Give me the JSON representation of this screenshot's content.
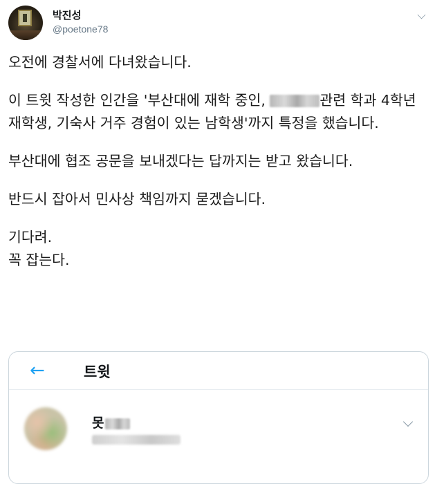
{
  "author": {
    "name": "박진성",
    "handle": "@poetone78"
  },
  "tweet": {
    "para1": "오전에 경찰서에 다녀왔습니다.",
    "para2_a": "이 트윗 작성한 인간을 '부산대에 재학 중인, ",
    "para2_b": "관련 학과 4학년 재학생, 기숙사 거주 경험이 있는 남학생'까지 특정을 했습니다.",
    "para3": "부산대에 협조 공문을 보내겠다는 답까지는 받고 왔습니다.",
    "para4": "반드시 잡아서 민사상 책임까지 묻겠습니다.",
    "para5_line1": "기다려.",
    "para5_line2": "꼭 잡는다."
  },
  "quoted_card": {
    "back_icon": "←",
    "title": "트윗",
    "name_visible": "못"
  },
  "icons": {
    "menu": "chevron-down-icon",
    "back": "back-arrow-icon"
  },
  "colors": {
    "accent": "#1da1f2",
    "handle": "#657786",
    "border": "#ccd6dd"
  }
}
